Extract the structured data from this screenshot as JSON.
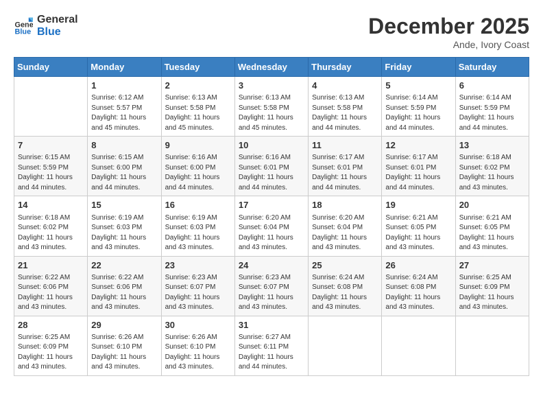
{
  "header": {
    "logo_line1": "General",
    "logo_line2": "Blue",
    "month_year": "December 2025",
    "location": "Ande, Ivory Coast"
  },
  "days_of_week": [
    "Sunday",
    "Monday",
    "Tuesday",
    "Wednesday",
    "Thursday",
    "Friday",
    "Saturday"
  ],
  "weeks": [
    [
      {
        "day": "",
        "sunrise": "",
        "sunset": "",
        "daylight": ""
      },
      {
        "day": "1",
        "sunrise": "6:12 AM",
        "sunset": "5:57 PM",
        "daylight": "11 hours and 45 minutes."
      },
      {
        "day": "2",
        "sunrise": "6:13 AM",
        "sunset": "5:58 PM",
        "daylight": "11 hours and 45 minutes."
      },
      {
        "day": "3",
        "sunrise": "6:13 AM",
        "sunset": "5:58 PM",
        "daylight": "11 hours and 45 minutes."
      },
      {
        "day": "4",
        "sunrise": "6:13 AM",
        "sunset": "5:58 PM",
        "daylight": "11 hours and 44 minutes."
      },
      {
        "day": "5",
        "sunrise": "6:14 AM",
        "sunset": "5:59 PM",
        "daylight": "11 hours and 44 minutes."
      },
      {
        "day": "6",
        "sunrise": "6:14 AM",
        "sunset": "5:59 PM",
        "daylight": "11 hours and 44 minutes."
      }
    ],
    [
      {
        "day": "7",
        "sunrise": "6:15 AM",
        "sunset": "5:59 PM",
        "daylight": "11 hours and 44 minutes."
      },
      {
        "day": "8",
        "sunrise": "6:15 AM",
        "sunset": "6:00 PM",
        "daylight": "11 hours and 44 minutes."
      },
      {
        "day": "9",
        "sunrise": "6:16 AM",
        "sunset": "6:00 PM",
        "daylight": "11 hours and 44 minutes."
      },
      {
        "day": "10",
        "sunrise": "6:16 AM",
        "sunset": "6:01 PM",
        "daylight": "11 hours and 44 minutes."
      },
      {
        "day": "11",
        "sunrise": "6:17 AM",
        "sunset": "6:01 PM",
        "daylight": "11 hours and 44 minutes."
      },
      {
        "day": "12",
        "sunrise": "6:17 AM",
        "sunset": "6:01 PM",
        "daylight": "11 hours and 44 minutes."
      },
      {
        "day": "13",
        "sunrise": "6:18 AM",
        "sunset": "6:02 PM",
        "daylight": "11 hours and 43 minutes."
      }
    ],
    [
      {
        "day": "14",
        "sunrise": "6:18 AM",
        "sunset": "6:02 PM",
        "daylight": "11 hours and 43 minutes."
      },
      {
        "day": "15",
        "sunrise": "6:19 AM",
        "sunset": "6:03 PM",
        "daylight": "11 hours and 43 minutes."
      },
      {
        "day": "16",
        "sunrise": "6:19 AM",
        "sunset": "6:03 PM",
        "daylight": "11 hours and 43 minutes."
      },
      {
        "day": "17",
        "sunrise": "6:20 AM",
        "sunset": "6:04 PM",
        "daylight": "11 hours and 43 minutes."
      },
      {
        "day": "18",
        "sunrise": "6:20 AM",
        "sunset": "6:04 PM",
        "daylight": "11 hours and 43 minutes."
      },
      {
        "day": "19",
        "sunrise": "6:21 AM",
        "sunset": "6:05 PM",
        "daylight": "11 hours and 43 minutes."
      },
      {
        "day": "20",
        "sunrise": "6:21 AM",
        "sunset": "6:05 PM",
        "daylight": "11 hours and 43 minutes."
      }
    ],
    [
      {
        "day": "21",
        "sunrise": "6:22 AM",
        "sunset": "6:06 PM",
        "daylight": "11 hours and 43 minutes."
      },
      {
        "day": "22",
        "sunrise": "6:22 AM",
        "sunset": "6:06 PM",
        "daylight": "11 hours and 43 minutes."
      },
      {
        "day": "23",
        "sunrise": "6:23 AM",
        "sunset": "6:07 PM",
        "daylight": "11 hours and 43 minutes."
      },
      {
        "day": "24",
        "sunrise": "6:23 AM",
        "sunset": "6:07 PM",
        "daylight": "11 hours and 43 minutes."
      },
      {
        "day": "25",
        "sunrise": "6:24 AM",
        "sunset": "6:08 PM",
        "daylight": "11 hours and 43 minutes."
      },
      {
        "day": "26",
        "sunrise": "6:24 AM",
        "sunset": "6:08 PM",
        "daylight": "11 hours and 43 minutes."
      },
      {
        "day": "27",
        "sunrise": "6:25 AM",
        "sunset": "6:09 PM",
        "daylight": "11 hours and 43 minutes."
      }
    ],
    [
      {
        "day": "28",
        "sunrise": "6:25 AM",
        "sunset": "6:09 PM",
        "daylight": "11 hours and 43 minutes."
      },
      {
        "day": "29",
        "sunrise": "6:26 AM",
        "sunset": "6:10 PM",
        "daylight": "11 hours and 43 minutes."
      },
      {
        "day": "30",
        "sunrise": "6:26 AM",
        "sunset": "6:10 PM",
        "daylight": "11 hours and 43 minutes."
      },
      {
        "day": "31",
        "sunrise": "6:27 AM",
        "sunset": "6:11 PM",
        "daylight": "11 hours and 44 minutes."
      },
      {
        "day": "",
        "sunrise": "",
        "sunset": "",
        "daylight": ""
      },
      {
        "day": "",
        "sunrise": "",
        "sunset": "",
        "daylight": ""
      },
      {
        "day": "",
        "sunrise": "",
        "sunset": "",
        "daylight": ""
      }
    ]
  ],
  "labels": {
    "sunrise_prefix": "Sunrise: ",
    "sunset_prefix": "Sunset: ",
    "daylight_prefix": "Daylight: "
  }
}
